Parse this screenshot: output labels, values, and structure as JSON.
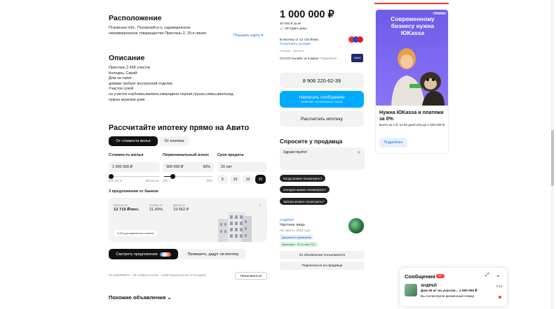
{
  "location": {
    "title": "Расположение",
    "address_line1": "Псковская обл., Псковский р-н, садоводческое",
    "address_line2": "некоммерческое товарищество Пристань-2, 29-я линия",
    "show_map": "Показать карту ▾"
  },
  "description": {
    "title": "Описание",
    "lines": [
      "Пристань 2.495 участок",
      "Колодец. Сарай.",
      "Дом на горке .",
      "домики требует внутренний отделки.",
      "Участок сухой",
      "на участке клубника,малина,смородина черная,груши,сливы,виноград,",
      "нужны мужские руки"
    ]
  },
  "mortgage": {
    "title": "Рассчитайте ипотеку прямо на Авито",
    "tab_price": "От стоимости жилья",
    "tab_payment": "От платежа",
    "label_price": "Стоимость жилья",
    "label_down": "Первоначальный взнос",
    "label_term": "Срок кредита",
    "price_value": "1 000 000 ₽",
    "down_value": "300 000 ₽",
    "down_percent": "30%",
    "term_value": "20 лет",
    "price_min": "600 тыс ₽",
    "price_max": "100 млн ₽",
    "down_min": "20%",
    "down_max": "90%",
    "term_options": [
      "5",
      "10",
      "15",
      "20"
    ],
    "selected_term": "20",
    "offers_title": "3 предложения от банков",
    "payment_label": "Платеж от",
    "payment_value": "12 715 ₽/мес.",
    "rate_label": "Ставка от",
    "rate_value": "21,49%",
    "income_label": "Доход от",
    "income_value": "19 562 ₽",
    "offer_badge": "−0,5% для зарплатного клиента",
    "btn_offers": "Смотреть предложения",
    "btn_check": "Проверить, дадут ли ипотеку"
  },
  "listing_meta": {
    "text": "№ 2949098072 · 25 ноября в 18:05 · 13930 просмотров (+0 сегодня)",
    "complain": "Пожаловаться"
  },
  "similar": {
    "title": "Похожие объявления ⌄"
  },
  "price_block": {
    "price": "1 000 000 ₽",
    "per_m2": "40 000 ₽ за м²",
    "history": "История цены",
    "mortgage_line": "В ипотеку от 12 715 ₽/мес.",
    "mortgage_link": "Посмотреть условия",
    "ad_label": "Реклама · alfa.vtb.ru",
    "osago": "ОСАГО онлайн за 5 минут",
    "osago_more": "Подробнее",
    "osago_logo": "ЗАКАЗ"
  },
  "contact": {
    "phone": "8 906 220-62-39",
    "message_btn": "Написать сообщение",
    "message_sub": "Отвечает за несколько часов",
    "mortgage_btn": "Рассчитать ипотеку"
  },
  "ask_seller": {
    "title": "Спросите у продавца",
    "input_value": "Здравствуйте!",
    "chips": [
      "Когда можно посмотреть?",
      "Сегодня можно посмотреть?",
      "Завтра можно посмотреть?"
    ]
  },
  "seller": {
    "name": "АНДРЕЙ",
    "type": "Частное лицо",
    "since": "На Авито с 2019 года",
    "docs_badge": "Документы проверены",
    "eco_badge": "Экономия · 12,5 тонн CO₂",
    "ads_btn": "61 объявление пользователя",
    "subscribe_btn": "Подписаться на продавца"
  },
  "ad_banner": {
    "badge": "Реклама",
    "headline": "Современному бизнесу нужна ЮKassa",
    "title": "Нужна ЮKassa и платежи за 0%",
    "body": "Всего за 1 ₽, на 90 дней или до 1 000 000 ₽",
    "button": "Подробнее"
  },
  "messages": {
    "title": "Сообщения",
    "badge": "99+",
    "sender": "АНДРЕЙ",
    "subject": "Дом 25 м² на участке... 1 000 000 ₽",
    "preview": "Вы посмотрели временный номер",
    "time": "9:15"
  },
  "colors": {
    "blue": "#00aaff",
    "accent_link": "#1e6fd9",
    "ad_purple": "#6b4fe0",
    "red": "#ff3b30"
  }
}
